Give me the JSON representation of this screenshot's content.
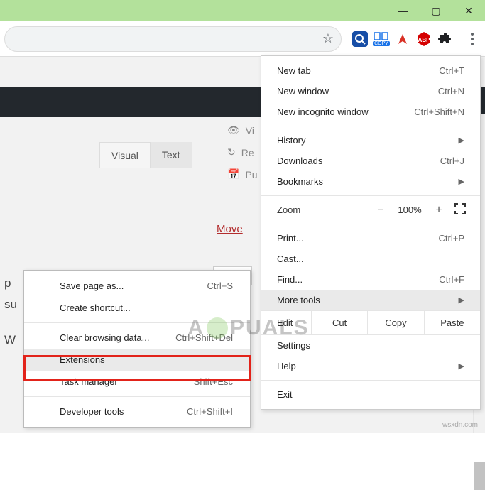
{
  "window_controls": {
    "min": "—",
    "max": "▢",
    "close": "✕"
  },
  "toolbar_icons": {
    "star": "☆",
    "search": "search",
    "copy_label": "COPY",
    "abp_label": "ABP",
    "puzzle": "★"
  },
  "page": {
    "tabs": {
      "visual": "Visual",
      "text": "Text"
    },
    "side": {
      "vi": "Vi",
      "re": "Re",
      "pu": "Pu"
    },
    "move": "Move",
    "letters": {
      "a": "p",
      "b": "su",
      "c": "W"
    }
  },
  "menu": {
    "new_tab": "New tab",
    "new_tab_sh": "Ctrl+T",
    "new_window": "New window",
    "new_window_sh": "Ctrl+N",
    "incog": "New incognito window",
    "incog_sh": "Ctrl+Shift+N",
    "history": "History",
    "downloads": "Downloads",
    "downloads_sh": "Ctrl+J",
    "bookmarks": "Bookmarks",
    "zoom": "Zoom",
    "zoom_minus": "−",
    "zoom_val": "100%",
    "zoom_plus": "+",
    "print": "Print...",
    "print_sh": "Ctrl+P",
    "cast": "Cast...",
    "find": "Find...",
    "find_sh": "Ctrl+F",
    "more_tools": "More tools",
    "edit": "Edit",
    "cut": "Cut",
    "copy": "Copy",
    "paste": "Paste",
    "settings": "Settings",
    "help": "Help",
    "exit": "Exit"
  },
  "submenu": {
    "save_page": "Save page as...",
    "save_page_sh": "Ctrl+S",
    "create_shortcut": "Create shortcut...",
    "clear_data": "Clear browsing data...",
    "clear_data_sh": "Ctrl+Shift+Del",
    "extensions": "Extensions",
    "task_manager": "Task manager",
    "task_manager_sh": "Shift+Esc",
    "dev_tools": "Developer tools",
    "dev_tools_sh": "Ctrl+Shift+I"
  },
  "watermark": {
    "a": "A",
    "p": "PUALS"
  },
  "footer": "wsxdn.com"
}
